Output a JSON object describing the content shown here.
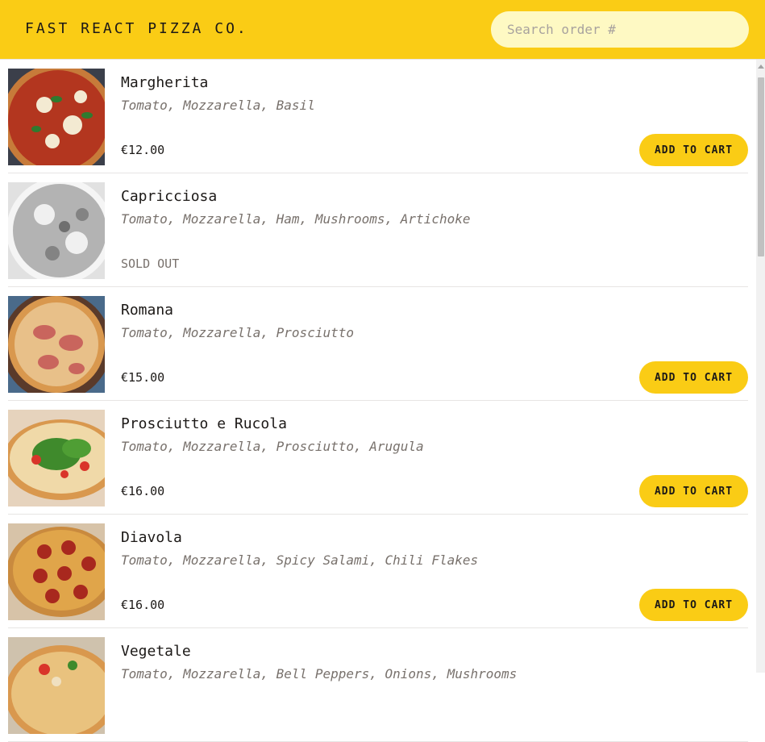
{
  "header": {
    "logo": "Fast React Pizza Co.",
    "search_placeholder": "Search order #"
  },
  "menu": [
    {
      "name": "Margherita",
      "ingredients": "Tomato, Mozzarella, Basil",
      "price": "€12.00",
      "sold_out": false,
      "button": "ADD TO CART",
      "image_icon": "pizza-margherita"
    },
    {
      "name": "Capricciosa",
      "ingredients": "Tomato, Mozzarella, Ham, Mushrooms, Artichoke",
      "status": "SOLD OUT",
      "sold_out": true,
      "image_icon": "pizza-capricciosa"
    },
    {
      "name": "Romana",
      "ingredients": "Tomato, Mozzarella, Prosciutto",
      "price": "€15.00",
      "sold_out": false,
      "button": "ADD TO CART",
      "image_icon": "pizza-romana"
    },
    {
      "name": "Prosciutto e Rucola",
      "ingredients": "Tomato, Mozzarella, Prosciutto, Arugula",
      "price": "€16.00",
      "sold_out": false,
      "button": "ADD TO CART",
      "image_icon": "pizza-prosciutto-rucola"
    },
    {
      "name": "Diavola",
      "ingredients": "Tomato, Mozzarella, Spicy Salami, Chili Flakes",
      "price": "€16.00",
      "sold_out": false,
      "button": "ADD TO CART",
      "image_icon": "pizza-diavola"
    },
    {
      "name": "Vegetale",
      "ingredients": "Tomato, Mozzarella, Bell Peppers, Onions, Mushrooms",
      "sold_out": false,
      "image_icon": "pizza-vegetale"
    }
  ],
  "colors": {
    "brand_yellow": "#facc15",
    "search_bg": "#fef9c3",
    "muted_text": "#78716c",
    "divider": "#e7e5e4"
  }
}
